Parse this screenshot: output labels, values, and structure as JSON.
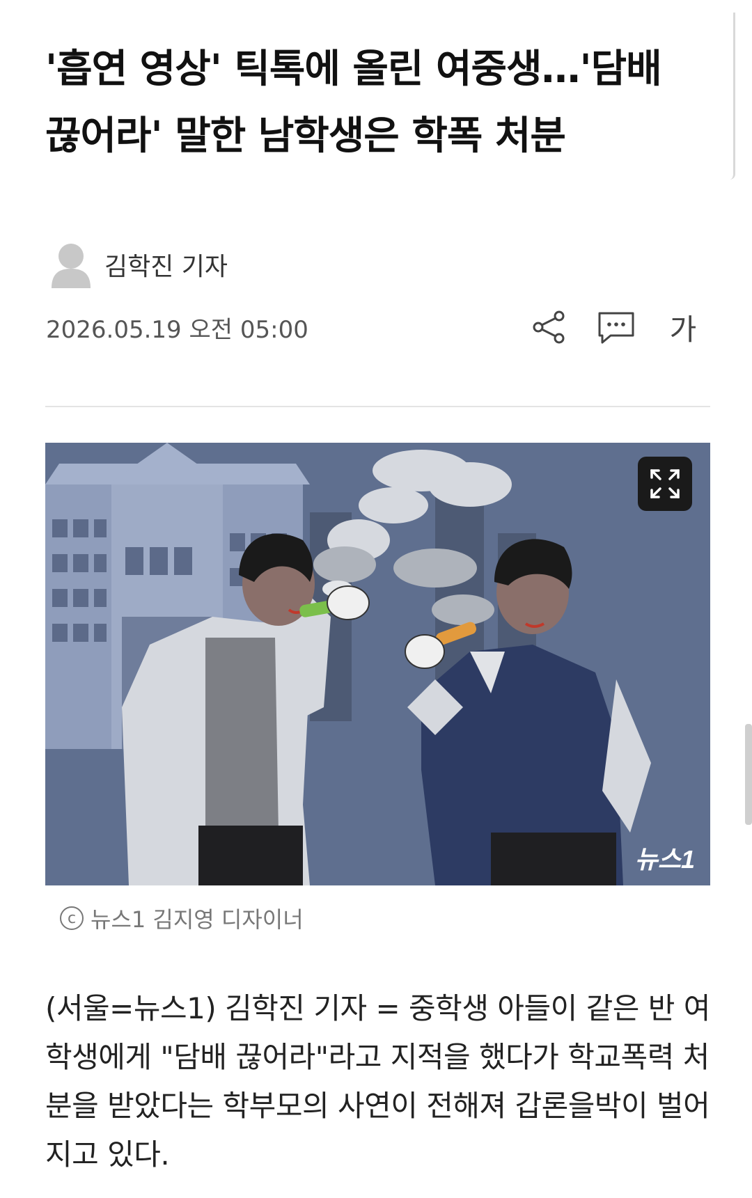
{
  "article": {
    "headline": "'흡연 영상' 틱톡에 올린 여중생…'담배 끊어라' 말한 남학생은 학폭 처분",
    "reporter": "김학진 기자",
    "date": "2026.05.19 오전 05:00",
    "font_size_label": "가",
    "photo_watermark": "뉴스1",
    "photo_caption": "뉴스1 김지영 디자이너",
    "copyright_symbol": "c",
    "body": "(서울=뉴스1) 김학진 기자 = 중학생 아들이 같은 반 여학생에게 \"담배 끊어라\"라고 지적을 했다가 학교폭력 처분을 받았다는 학부모의 사연이 전해져 갑론을박이 벌어지고 있다."
  },
  "icons": {
    "share": "share-icon",
    "comment": "comment-icon",
    "expand": "expand-icon",
    "avatar": "avatar-icon"
  },
  "colors": {
    "photo_background": "#5f6f8f",
    "headline": "#111111",
    "meta_text": "#555555"
  }
}
